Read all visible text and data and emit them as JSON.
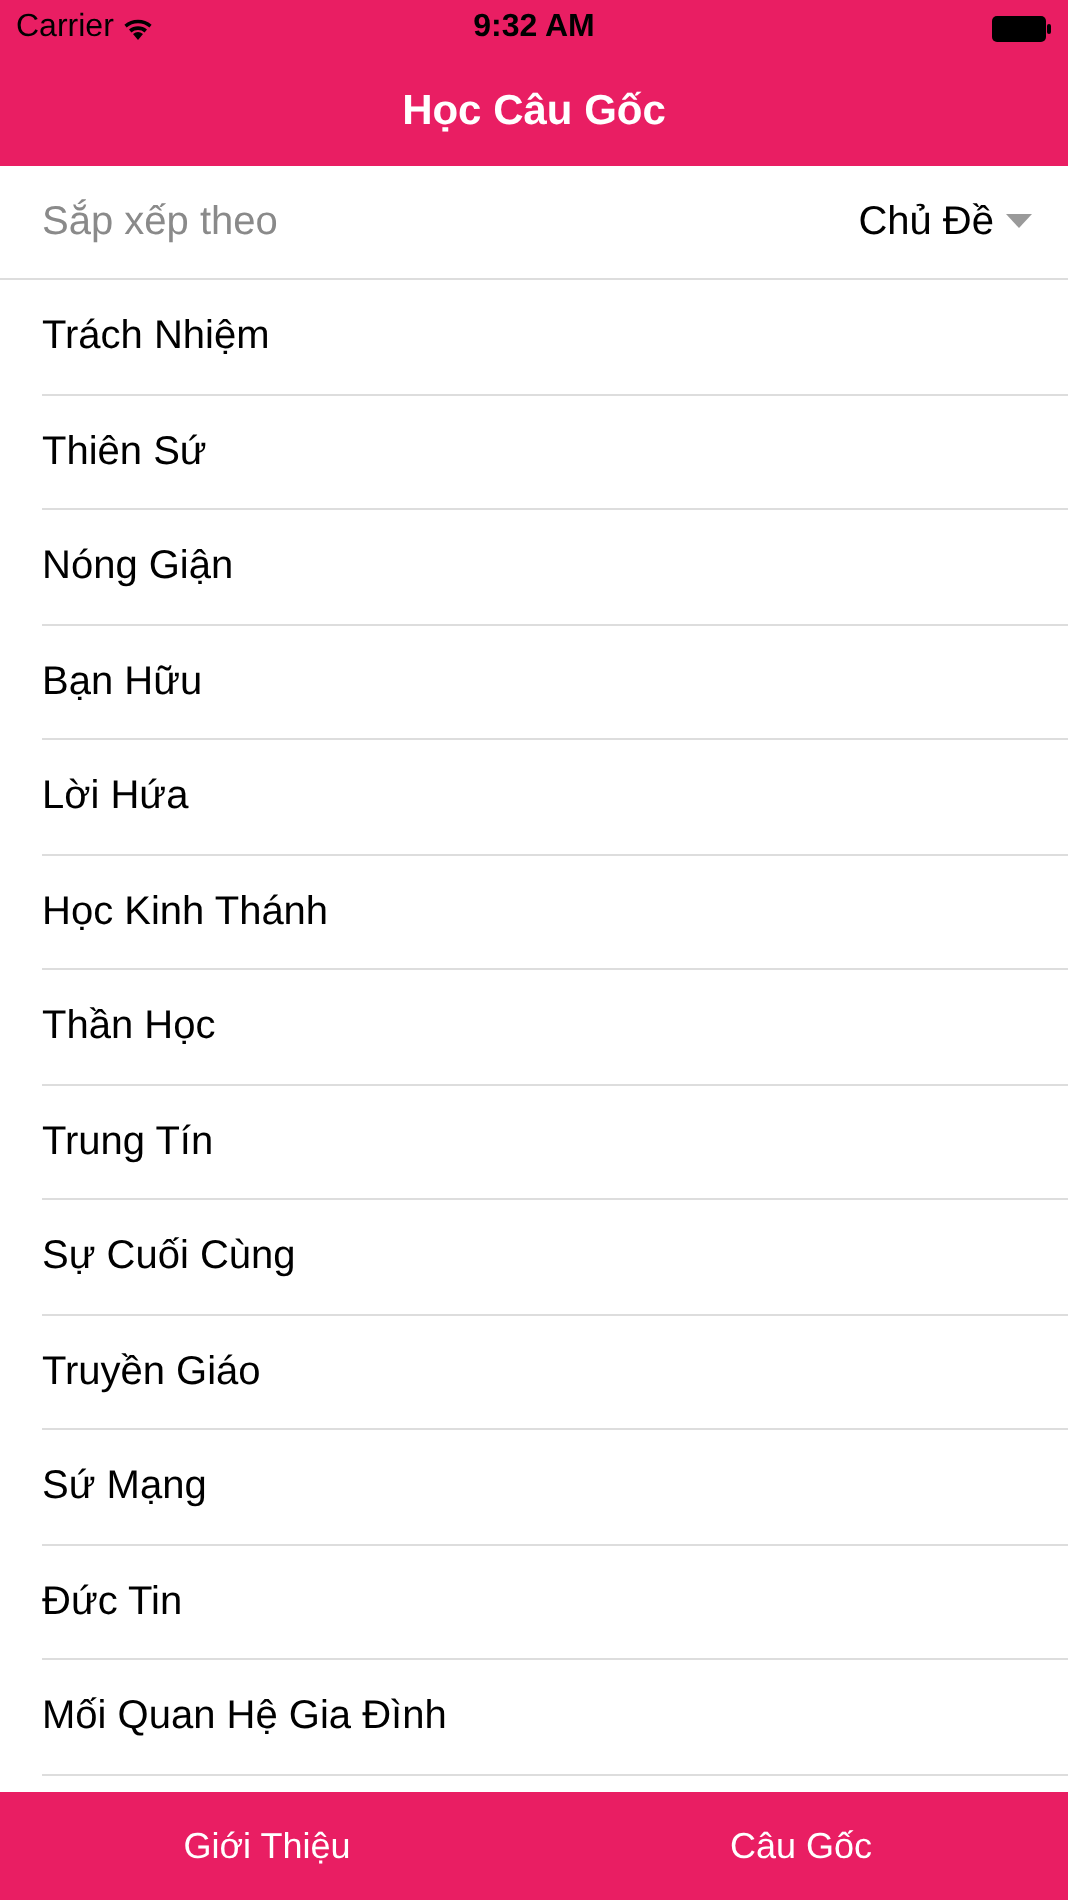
{
  "status_bar": {
    "carrier": "Carrier",
    "time": "9:32 AM"
  },
  "nav_bar": {
    "title": "Học Câu Gốc"
  },
  "sort": {
    "label": "Sắp xếp theo",
    "value": "Chủ Đề"
  },
  "topics": [
    {
      "label": "Trách Nhiệm"
    },
    {
      "label": "Thiên Sứ"
    },
    {
      "label": "Nóng Giận"
    },
    {
      "label": "Bạn Hữu"
    },
    {
      "label": "Lời Hứa"
    },
    {
      "label": "Học Kinh Thánh"
    },
    {
      "label": "Thần Học"
    },
    {
      "label": "Trung Tín"
    },
    {
      "label": "Sự Cuối Cùng"
    },
    {
      "label": "Truyền Giáo"
    },
    {
      "label": "Sứ Mạng"
    },
    {
      "label": "Đức Tin"
    },
    {
      "label": "Mối Quan Hệ Gia Đình"
    }
  ],
  "tab_bar": [
    {
      "label": "Giới Thiệu"
    },
    {
      "label": "Câu Gốc"
    }
  ]
}
